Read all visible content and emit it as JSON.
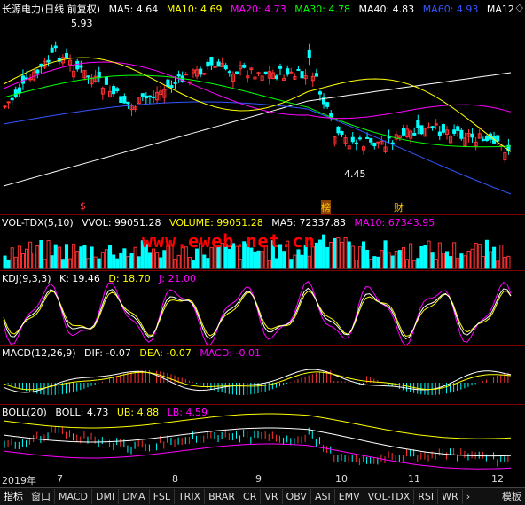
{
  "main": {
    "title": "长源电力(日线 前复权)",
    "ma5": "MA5: 4.64",
    "ma10": "MA10: 4.69",
    "ma20": "MA20: 4.73",
    "ma30": "MA30: 4.78",
    "ma40": "MA40: 4.83",
    "ma60": "MA60: 4.93",
    "ma12": "MA12",
    "high_label": "5.93",
    "low_label": "4.45",
    "marker_s": "$",
    "marker_bang": "榜",
    "marker_cai": "财",
    "colors": {
      "ma5": "#ffffff",
      "ma10": "#ffff00",
      "ma20": "#ff00ff",
      "ma30": "#00ff00",
      "ma40": "#ffffff",
      "ma60": "#0000ff"
    }
  },
  "vol": {
    "title": "VOL-TDX(5,10)",
    "vvol": "VVOL: 99051.28",
    "volume": "VOLUME: 99051.28",
    "ma5": "MA5: 72337.83",
    "ma10": "MA10: 67343.95"
  },
  "watermark": "www.eweb.net.cn",
  "kdj": {
    "title": "KDJ(9,3,3)",
    "k": "K: 19.46",
    "d": "D: 18.70",
    "j": "J: 21.00"
  },
  "macd": {
    "title": "MACD(12,26,9)",
    "dif": "DIF: -0.07",
    "dea": "DEA: -0.07",
    "macd": "MACD: -0.01"
  },
  "boll": {
    "title": "BOLL(20)",
    "boll": "BOLL: 4.73",
    "ub": "UB: 4.88",
    "lb": "LB: 4.59"
  },
  "xaxis": [
    "2019年",
    "7",
    "8",
    "9",
    "10",
    "11",
    "12"
  ],
  "tabs": [
    "指标",
    "窗口",
    "MACD",
    "DMI",
    "DMA",
    "FSL",
    "TRIX",
    "BRAR",
    "CR",
    "VR",
    "OBV",
    "ASI",
    "EMV",
    "VOL-TDX",
    "RSI",
    "WR"
  ],
  "tab_right": "模板"
}
